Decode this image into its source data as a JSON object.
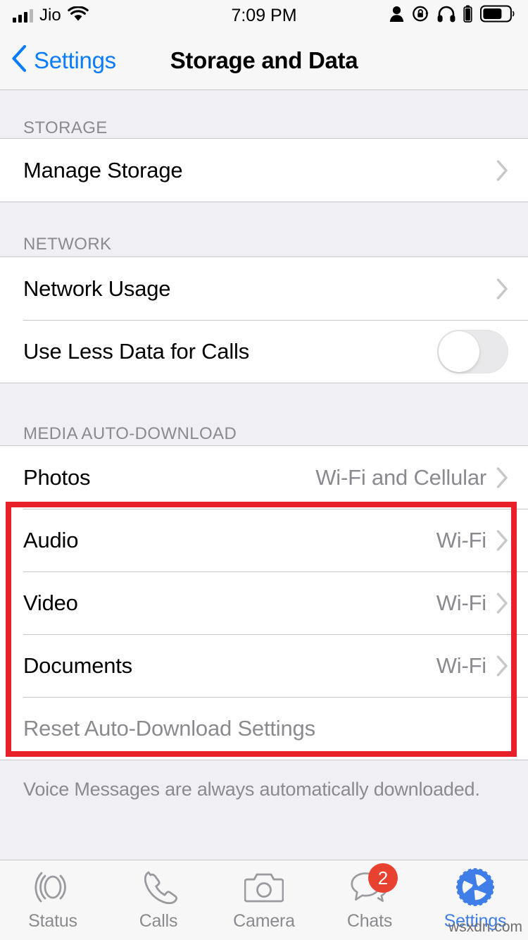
{
  "status_bar": {
    "carrier": "Jio",
    "time": "7:09 PM",
    "signal_bars_filled": 3,
    "signal_bars_total": 4,
    "icons": [
      "signal-bars-icon",
      "wifi-icon",
      "person-icon",
      "rotation-lock-icon",
      "headphones-icon",
      "headphones-battery-icon",
      "battery-icon"
    ]
  },
  "nav": {
    "back_label": "Settings",
    "title": "Storage and Data"
  },
  "sections": [
    {
      "header": "STORAGE",
      "rows": [
        {
          "label": "Manage Storage",
          "value": "",
          "accessory": "chevron"
        }
      ]
    },
    {
      "header": "NETWORK",
      "rows": [
        {
          "label": "Network Usage",
          "value": "",
          "accessory": "chevron"
        },
        {
          "label": "Use Less Data for Calls",
          "value": "",
          "accessory": "toggle",
          "toggle_on": false
        }
      ]
    },
    {
      "header": "MEDIA AUTO-DOWNLOAD",
      "rows": [
        {
          "label": "Photos",
          "value": "Wi-Fi and Cellular",
          "accessory": "chevron"
        },
        {
          "label": "Audio",
          "value": "Wi-Fi",
          "accessory": "chevron"
        },
        {
          "label": "Video",
          "value": "Wi-Fi",
          "accessory": "chevron"
        },
        {
          "label": "Documents",
          "value": "Wi-Fi",
          "accessory": "chevron"
        },
        {
          "label": "Reset Auto-Download Settings",
          "value": "",
          "accessory": "none"
        }
      ],
      "footnote": "Voice Messages are always automatically downloaded."
    }
  ],
  "highlight": {
    "color": "#e8202a",
    "covers": [
      "Photos",
      "Audio",
      "Video",
      "Documents"
    ]
  },
  "tab_bar": {
    "items": [
      {
        "label": "Status",
        "icon": "status-rings-icon",
        "active": false,
        "badge": ""
      },
      {
        "label": "Calls",
        "icon": "phone-icon",
        "active": false,
        "badge": ""
      },
      {
        "label": "Camera",
        "icon": "camera-icon",
        "active": false,
        "badge": ""
      },
      {
        "label": "Chats",
        "icon": "chat-bubbles-icon",
        "active": false,
        "badge": "2"
      },
      {
        "label": "Settings",
        "icon": "gear-icon",
        "active": true,
        "badge": ""
      }
    ],
    "active_color": "#3f7ee8",
    "inactive_color": "#8a8a8f"
  },
  "watermark": "wsxdn.com"
}
